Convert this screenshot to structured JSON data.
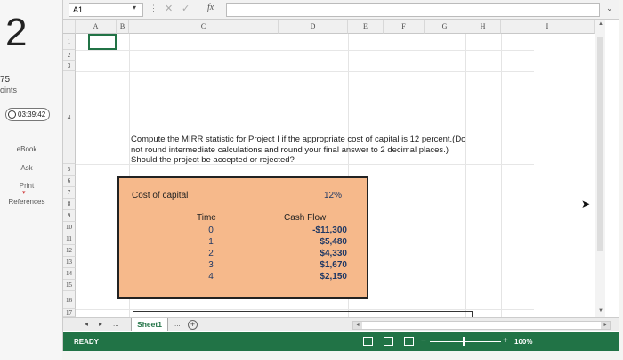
{
  "quiz": {
    "question_number": "2",
    "points_value": "75",
    "points_label": "oints",
    "timer": "03:39:42",
    "links": [
      "eBook",
      "Ask",
      "Print",
      "References"
    ]
  },
  "formula_bar": {
    "name_box": "A1",
    "fx": "fx"
  },
  "columns": [
    "A",
    "B",
    "C",
    "D",
    "E",
    "F",
    "G",
    "H",
    "I"
  ],
  "rows": [
    "1",
    "2",
    "3",
    "4",
    "5",
    "6",
    "7",
    "8",
    "9",
    "10",
    "11",
    "12",
    "13",
    "14",
    "15",
    "16",
    "17"
  ],
  "question_text": "Compute the MIRR statistic for Project I if the appropriate cost of capital is 12 percent.(Do not round intermediate calculations and round your final answer to 2 decimal places.) Should the project be accepted or rejected?",
  "cost_of_capital": {
    "label": "Cost of capital",
    "rate": "12%"
  },
  "cash_flow_table": {
    "time_header": "Time",
    "cf_header": "Cash Flow",
    "times": [
      "0",
      "1",
      "2",
      "3",
      "4"
    ],
    "flows": [
      "-$11,300",
      "$5,480",
      "$4,330",
      "$1,670",
      "$2,150"
    ]
  },
  "tabs": {
    "sheet_name": "Sheet1",
    "more": "...",
    "add": "+"
  },
  "status": {
    "mode": "READY",
    "zoom": "100%"
  },
  "colors": {
    "excel_green": "#217346",
    "highlight_fill": "#f6b98b",
    "value_text": "#1f3864"
  }
}
